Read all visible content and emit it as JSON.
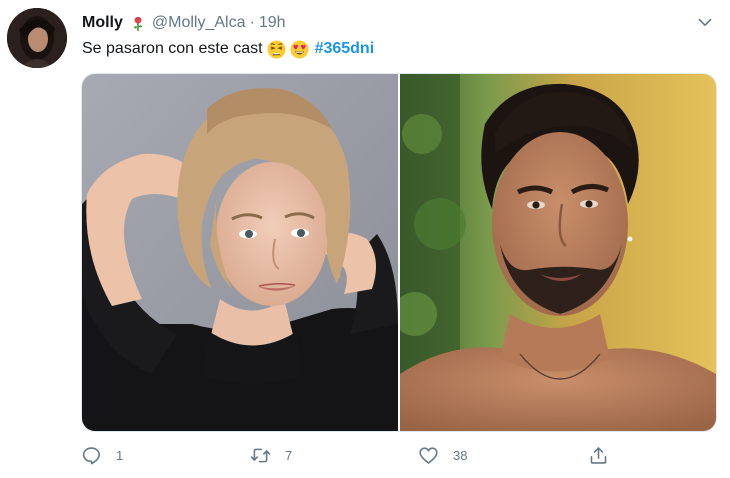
{
  "tweet": {
    "display_name": "Molly",
    "handle": "@Molly_Alca",
    "separator": "·",
    "timestamp": "19h",
    "text": "Se pasaron con este cast",
    "emojis": [
      "weary-face",
      "heart-eyes-face"
    ],
    "hashtag": "#365dni",
    "name_decoration": "rose-icon"
  },
  "media": {
    "count": 2,
    "photos": [
      {
        "subject": "woman-portrait"
      },
      {
        "subject": "man-portrait"
      }
    ]
  },
  "actions": {
    "reply_count": "1",
    "retweet_count": "7",
    "like_count": "38",
    "share_label": ""
  },
  "colors": {
    "text": "#14171a",
    "secondary": "#657786",
    "hashtag": "#1b95e0",
    "border": "#e1e8ed"
  }
}
